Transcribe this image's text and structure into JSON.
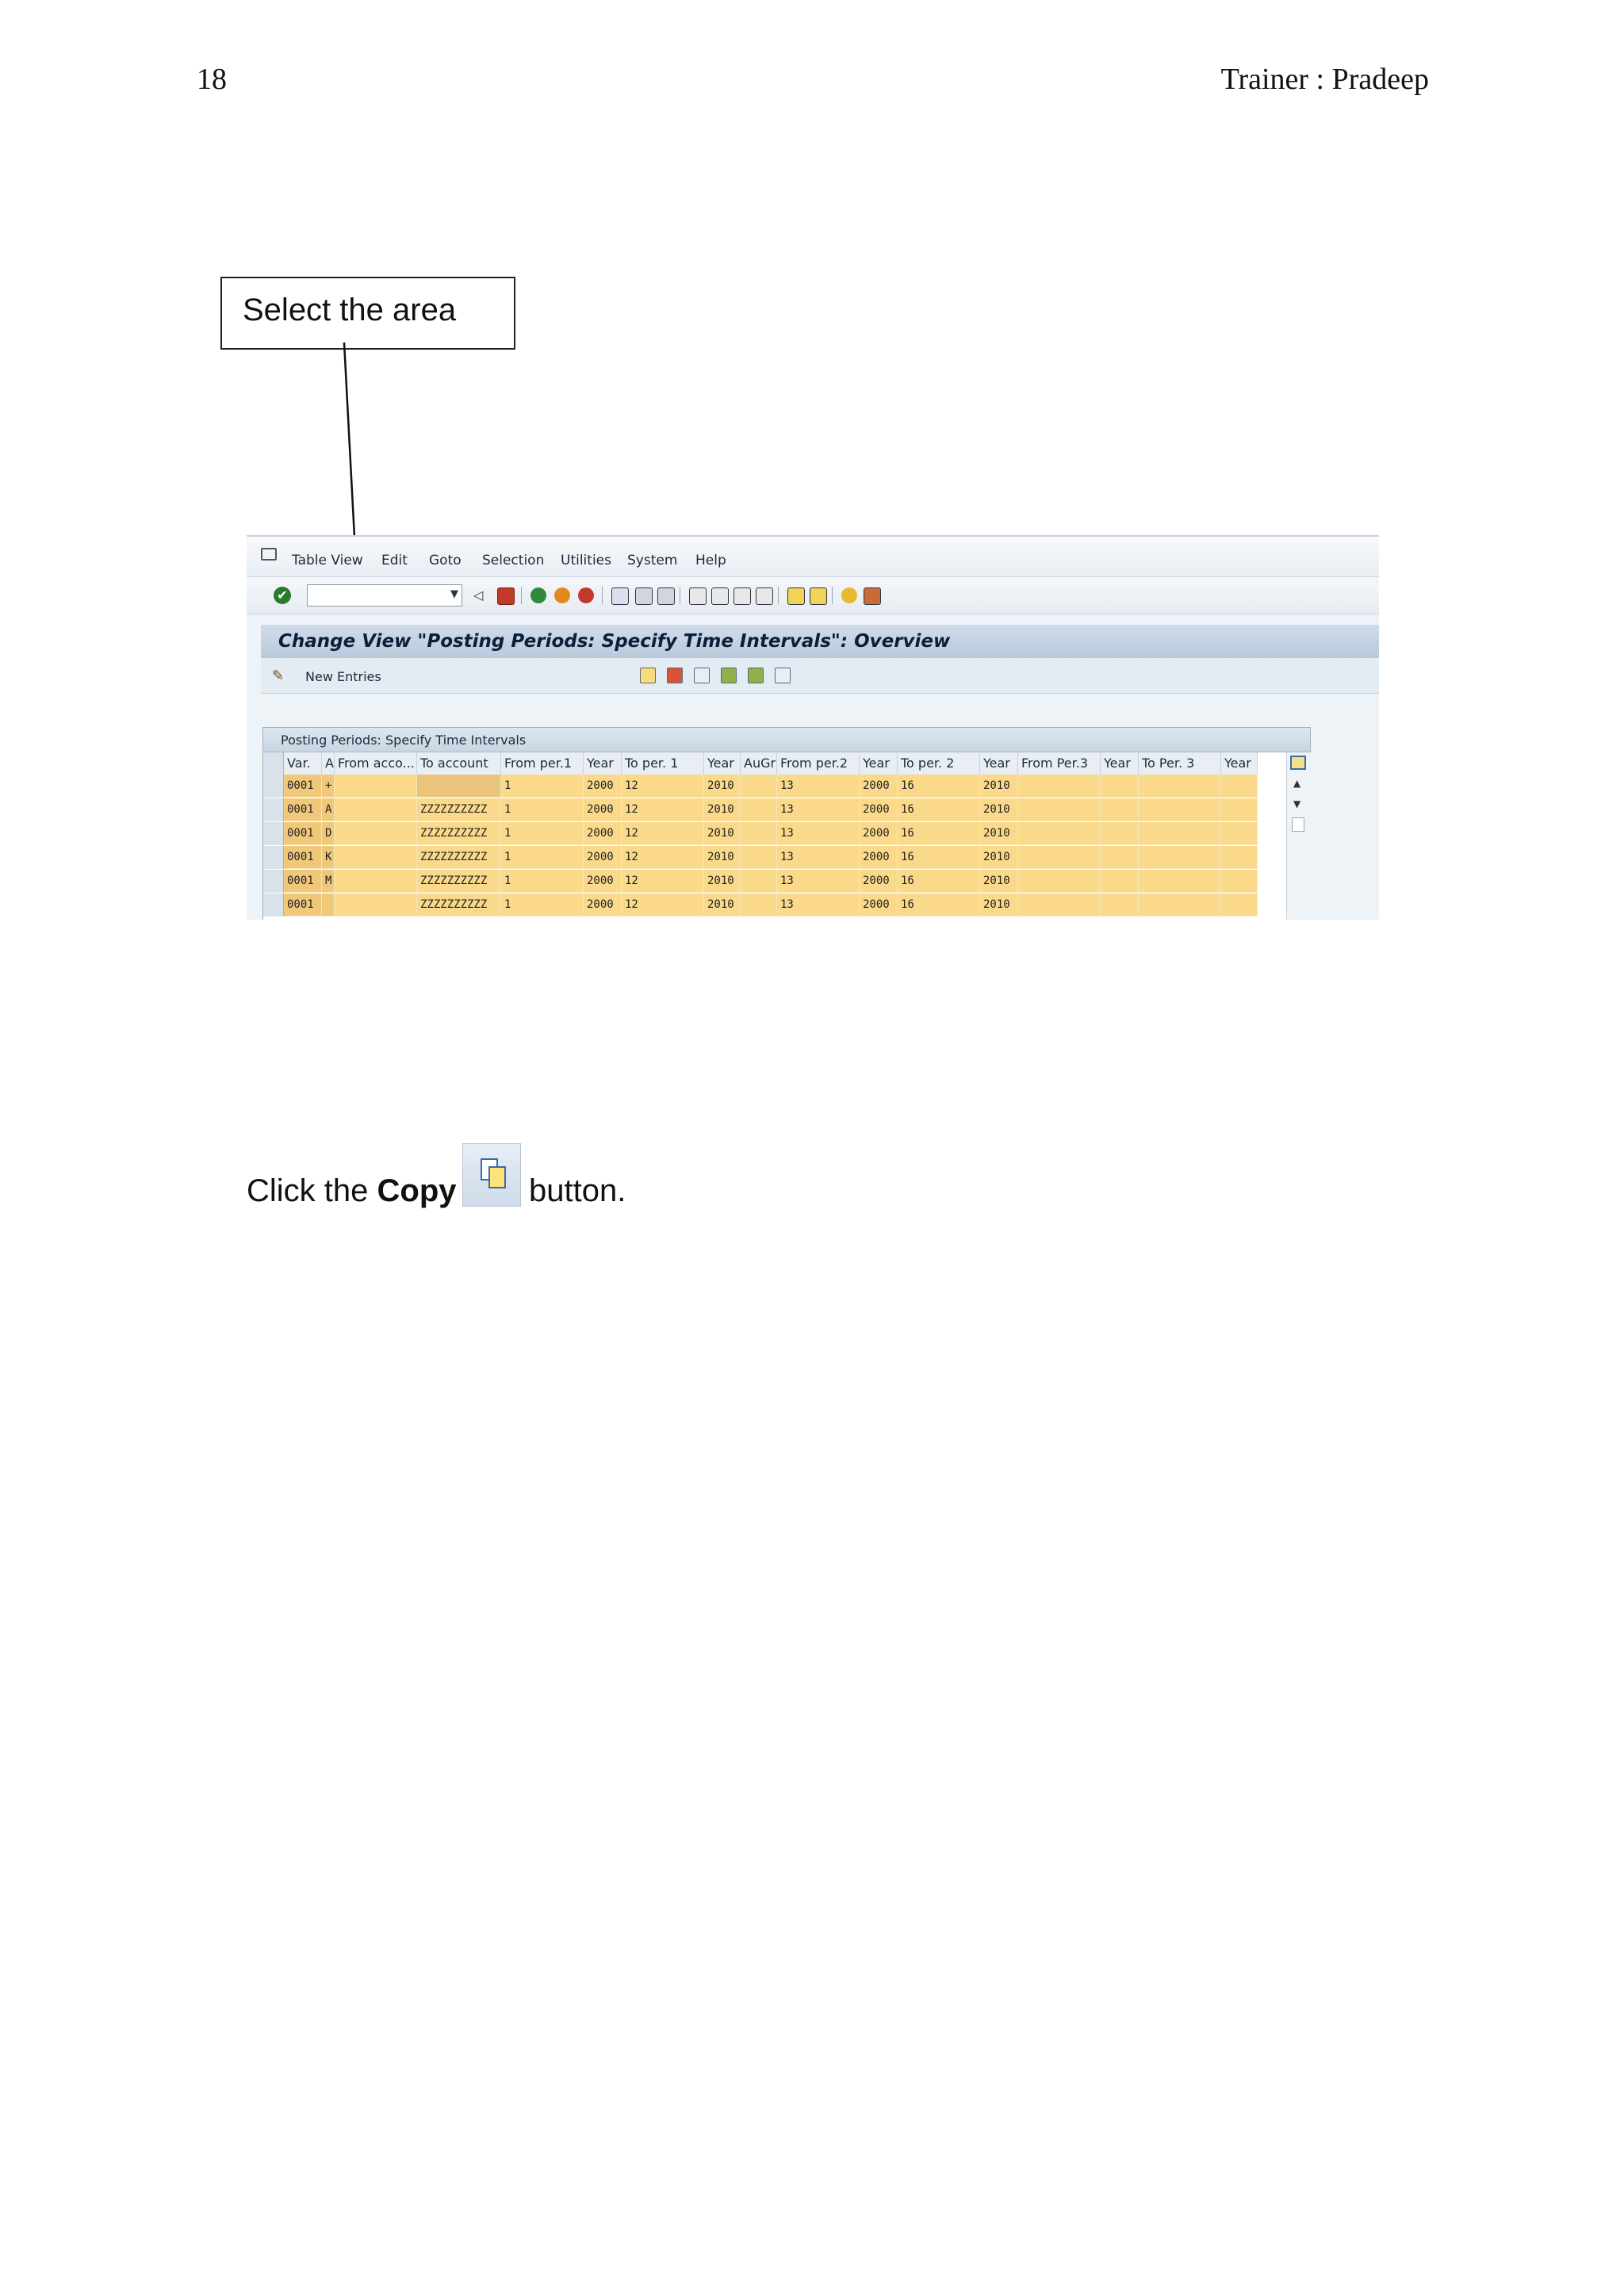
{
  "header": {
    "page_number": "18",
    "trainer": "Trainer : Pradeep"
  },
  "callout": {
    "text": "Select the area"
  },
  "sap": {
    "menu": [
      "Table View",
      "Edit",
      "Goto",
      "Selection",
      "Utilities",
      "System",
      "Help"
    ],
    "title": "Change View \"Posting Periods: Specify Time Intervals\": Overview",
    "new_entries": "New Entries",
    "table_caption": "Posting Periods: Specify Time Intervals",
    "columns": [
      "Var.",
      "A",
      "From acco...",
      "To account",
      "From per.1",
      "Year",
      "To per. 1",
      "Year",
      "AuGr",
      "From per.2",
      "Year",
      "To per. 2",
      "Year",
      "From Per.3",
      "Year",
      "To Per. 3",
      "Year"
    ],
    "rows": [
      [
        "0001",
        "+",
        "",
        "",
        "1",
        "2000",
        "12",
        "2010",
        "",
        "13",
        "2000",
        "16",
        "2010",
        "",
        "",
        "",
        ""
      ],
      [
        "0001",
        "A",
        "",
        "ZZZZZZZZZZ",
        "1",
        "2000",
        "12",
        "2010",
        "",
        "13",
        "2000",
        "16",
        "2010",
        "",
        "",
        "",
        ""
      ],
      [
        "0001",
        "D",
        "",
        "ZZZZZZZZZZ",
        "1",
        "2000",
        "12",
        "2010",
        "",
        "13",
        "2000",
        "16",
        "2010",
        "",
        "",
        "",
        ""
      ],
      [
        "0001",
        "K",
        "",
        "ZZZZZZZZZZ",
        "1",
        "2000",
        "12",
        "2010",
        "",
        "13",
        "2000",
        "16",
        "2010",
        "",
        "",
        "",
        ""
      ],
      [
        "0001",
        "M",
        "",
        "ZZZZZZZZZZ",
        "1",
        "2000",
        "12",
        "2010",
        "",
        "13",
        "2000",
        "16",
        "2010",
        "",
        "",
        "",
        ""
      ],
      [
        "0001",
        "",
        "",
        "ZZZZZZZZZZ",
        "1",
        "2000",
        "12",
        "2010",
        "",
        "13",
        "2000",
        "16",
        "2010",
        "",
        "",
        "",
        ""
      ]
    ]
  },
  "instruction": {
    "prefix": "Click the ",
    "bold": "Copy",
    "suffix": " button."
  },
  "colors": {
    "row_fill": "#fbd98a",
    "title_bar": "#c4d3e4",
    "key_fill": "#f0c87a"
  }
}
